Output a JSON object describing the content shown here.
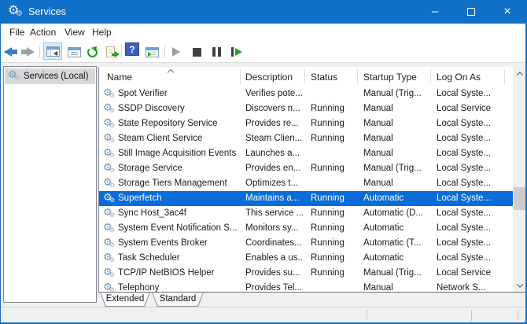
{
  "window": {
    "title": "Services",
    "controls": [
      {
        "name": "minimize",
        "glyph": "–"
      },
      {
        "name": "maximize",
        "glyph": ""
      },
      {
        "name": "close",
        "glyph": "×"
      }
    ]
  },
  "menu": {
    "items": [
      "File",
      "Action",
      "View",
      "Help"
    ]
  },
  "toolbar": {
    "buttons": [
      {
        "name": "back"
      },
      {
        "name": "forward"
      },
      {
        "name": "show-console-tree",
        "active": true
      },
      {
        "name": "properties"
      },
      {
        "name": "refresh"
      },
      {
        "name": "export-list"
      },
      {
        "name": "help",
        "glyph": "?"
      },
      {
        "name": "new-window"
      },
      {
        "name": "start-service"
      },
      {
        "name": "stop-service"
      },
      {
        "name": "pause-service"
      },
      {
        "name": "restart-service"
      }
    ]
  },
  "tree": {
    "items": [
      {
        "label": "Services (Local)",
        "selected": true
      }
    ]
  },
  "list": {
    "columns": [
      {
        "label": "Name",
        "sorted": "asc"
      },
      {
        "label": "Description"
      },
      {
        "label": "Status"
      },
      {
        "label": "Startup Type"
      },
      {
        "label": "Log On As"
      }
    ],
    "rows": [
      {
        "name": "Spot Verifier",
        "description": "Verifies pote...",
        "status": "",
        "startup_type": "Manual (Trig...",
        "log_on_as": "Local Syste..."
      },
      {
        "name": "SSDP Discovery",
        "description": "Discovers n...",
        "status": "Running",
        "startup_type": "Manual",
        "log_on_as": "Local Service"
      },
      {
        "name": "State Repository Service",
        "description": "Provides re...",
        "status": "Running",
        "startup_type": "Manual",
        "log_on_as": "Local Syste..."
      },
      {
        "name": "Steam Client Service",
        "description": "Steam Clien...",
        "status": "Running",
        "startup_type": "Manual",
        "log_on_as": "Local Syste..."
      },
      {
        "name": "Still Image Acquisition Events",
        "description": "Launches a...",
        "status": "",
        "startup_type": "Manual",
        "log_on_as": "Local Syste..."
      },
      {
        "name": "Storage Service",
        "description": "Provides en...",
        "status": "Running",
        "startup_type": "Manual (Trig...",
        "log_on_as": "Local Syste..."
      },
      {
        "name": "Storage Tiers Management",
        "description": "Optimizes t...",
        "status": "",
        "startup_type": "Manual",
        "log_on_as": "Local Syste..."
      },
      {
        "name": "Superfetch",
        "description": "Maintains a...",
        "status": "Running",
        "startup_type": "Automatic",
        "log_on_as": "Local Syste...",
        "selected": true
      },
      {
        "name": "Sync Host_3ac4f",
        "description": "This service ...",
        "status": "Running",
        "startup_type": "Automatic (D...",
        "log_on_as": "Local Syste..."
      },
      {
        "name": "System Event Notification S...",
        "description": "Monitors sy...",
        "status": "Running",
        "startup_type": "Automatic",
        "log_on_as": "Local Syste..."
      },
      {
        "name": "System Events Broker",
        "description": "Coordinates...",
        "status": "Running",
        "startup_type": "Automatic (T...",
        "log_on_as": "Local Syste..."
      },
      {
        "name": "Task Scheduler",
        "description": "Enables a us...",
        "status": "Running",
        "startup_type": "Automatic",
        "log_on_as": "Local Syste..."
      },
      {
        "name": "TCP/IP NetBIOS Helper",
        "description": "Provides su...",
        "status": "Running",
        "startup_type": "Manual (Trig...",
        "log_on_as": "Local Service"
      },
      {
        "name": "Telephony",
        "description": "Provides Tel...",
        "status": "",
        "startup_type": "Manual",
        "log_on_as": "Network S..."
      }
    ]
  },
  "tabs": {
    "items": [
      "Extended",
      "Standard"
    ],
    "active_index": 0
  },
  "icons": {
    "gear": "⚙"
  },
  "colors": {
    "titlebar": "#1070c8",
    "selection": "#0a6dd7",
    "window_border": "#1070c8"
  }
}
